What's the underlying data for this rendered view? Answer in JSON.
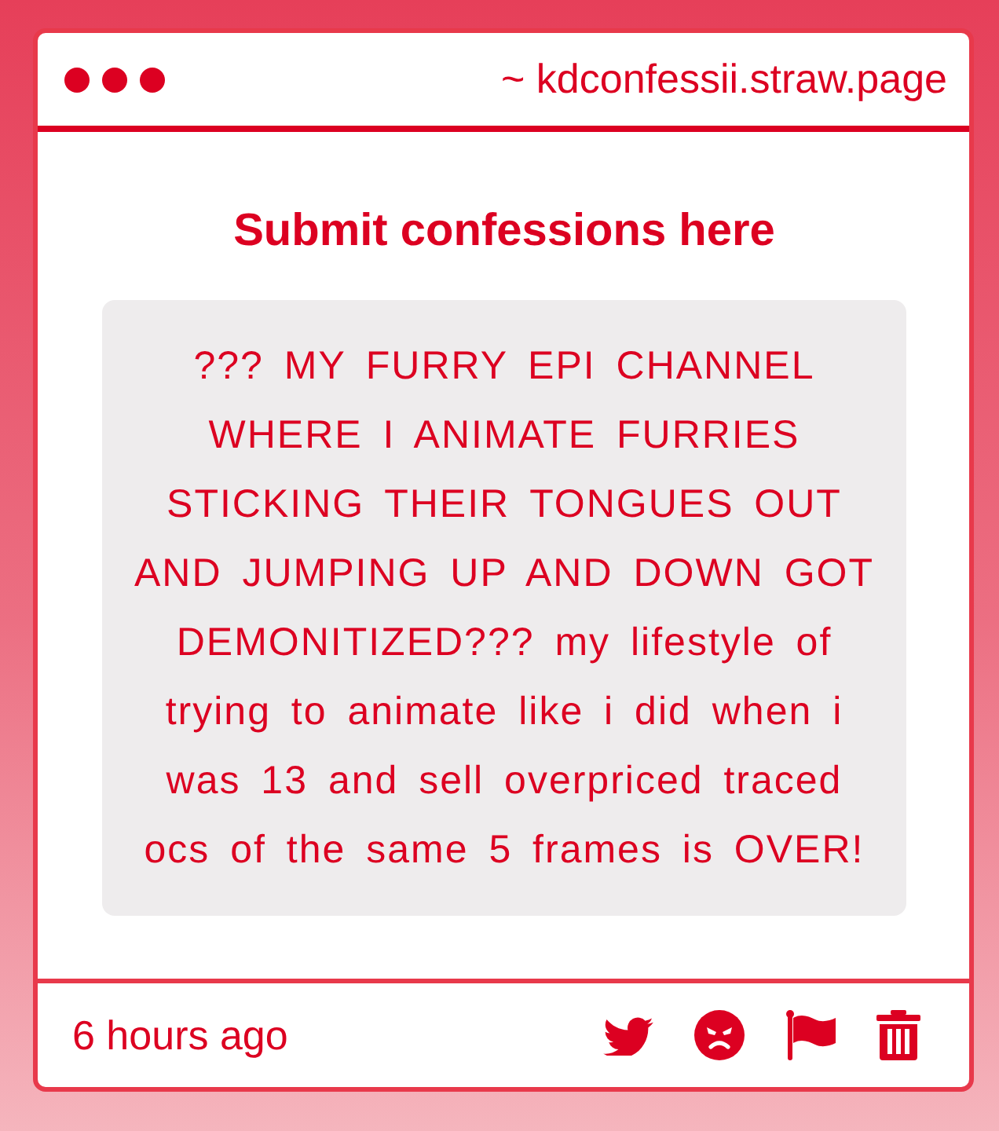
{
  "window": {
    "address": "~ kdconfessii.straw.page"
  },
  "heading": "Submit confessions here",
  "confession": {
    "text": "??? MY FURRY EPI CHANNEL WHERE I ANIMATE FURRIES STICKING THEIR TONGUES OUT AND JUMPING UP AND DOWN GOT DEMONITIZED??? my lifestyle of trying to animate like i did when i was 13 and sell overpriced traced ocs of the same 5 frames is OVER!"
  },
  "footer": {
    "time": "6 hours ago",
    "actions": [
      {
        "kind": "share"
      },
      {
        "kind": "react"
      },
      {
        "kind": "report"
      },
      {
        "kind": "delete"
      }
    ]
  }
}
